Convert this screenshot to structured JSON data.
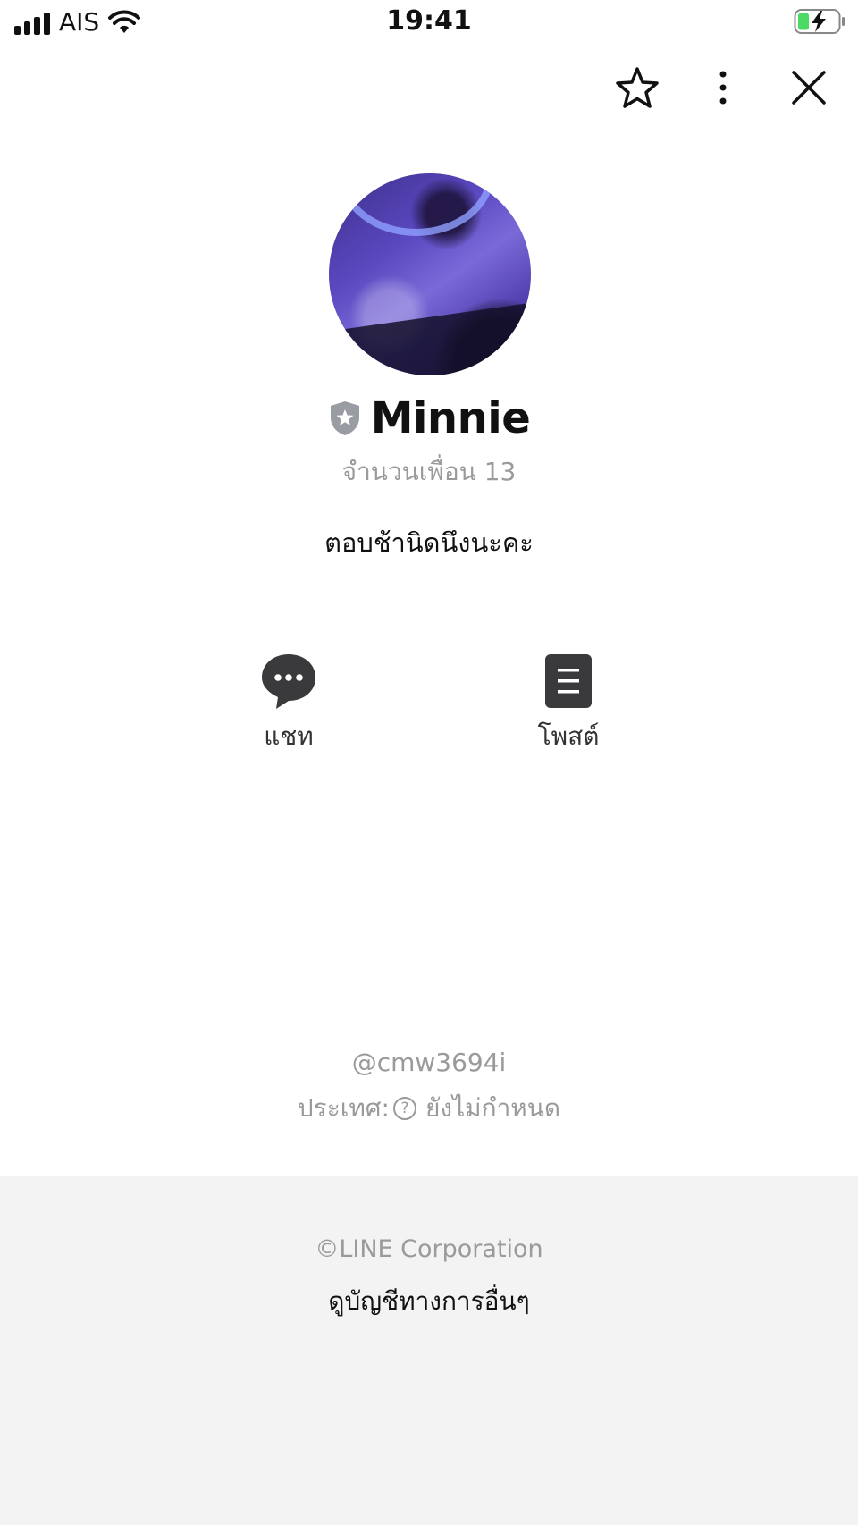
{
  "status_bar": {
    "carrier": "AIS",
    "time": "19:41",
    "signal_icon": "signal-bars-icon",
    "wifi_icon": "wifi-icon",
    "battery_icon": "battery-charging-icon"
  },
  "top_actions": [
    {
      "icon": "star-icon"
    },
    {
      "icon": "more-vertical-icon"
    },
    {
      "icon": "close-icon"
    }
  ],
  "profile": {
    "name": "Minnie",
    "badge_icon": "shield-star-icon",
    "friends_label": "จำนวนเพื่อน 13",
    "status_message": "ตอบช้านิดนึงนะคะ"
  },
  "actions": {
    "chat_label": "แชท",
    "post_label": "โพสต์"
  },
  "info": {
    "line_id": "@cmw3694i",
    "country_label": "ประเทศ:",
    "country_value": "ยังไม่กำหนด"
  },
  "footer": {
    "copyright": "©LINE Corporation",
    "other_accounts_link": "ดูบัญชีทางการอื่นๆ"
  },
  "colors": {
    "text_primary": "#111111",
    "text_secondary": "#9a9a9a",
    "icon_dark": "#3a3a3c",
    "footer_bg": "#f3f3f3",
    "battery_green": "#4cd964"
  }
}
